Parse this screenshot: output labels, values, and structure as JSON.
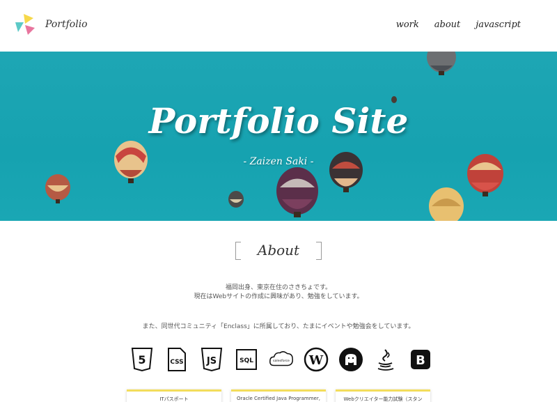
{
  "header": {
    "brand": "Portfolio",
    "nav": [
      {
        "label": "work"
      },
      {
        "label": "about"
      },
      {
        "label": "javascript"
      }
    ]
  },
  "hero": {
    "title": "Portfolio Site",
    "subtitle": "- Zaizen Saki -"
  },
  "about": {
    "title": "About",
    "lines": [
      "福岡出身、東京在住のさきちょです。",
      "現在はWebサイトの作成に興味があり、勉強をしています。",
      "また、同世代コミュニティ「Enclass」に所属しており、たまにイベントや勉強会をしています。"
    ]
  },
  "skills": [
    {
      "icon": "html5-icon",
      "label": "5"
    },
    {
      "icon": "css-icon",
      "label": "CSS"
    },
    {
      "icon": "javascript-icon",
      "label": "JS"
    },
    {
      "icon": "sql-icon",
      "label": "SQL"
    },
    {
      "icon": "salesforce-icon",
      "label": "salesforce"
    },
    {
      "icon": "wordpress-icon",
      "label": "W"
    },
    {
      "icon": "github-icon",
      "label": ""
    },
    {
      "icon": "java-icon",
      "label": ""
    },
    {
      "icon": "bootstrap-icon",
      "label": "B"
    }
  ],
  "cards": [
    {
      "label": "ITパスポート"
    },
    {
      "label": "Oracle Certified Java Programmer,"
    },
    {
      "label": "Webクリエイター能力試験（スタン"
    }
  ],
  "colors": {
    "hero_bg": "#1ea6b4",
    "card_accent": "#f3dd5b",
    "logo_yellow": "#f6d84a",
    "logo_teal": "#5cc9c7",
    "logo_pink": "#e8759e"
  }
}
